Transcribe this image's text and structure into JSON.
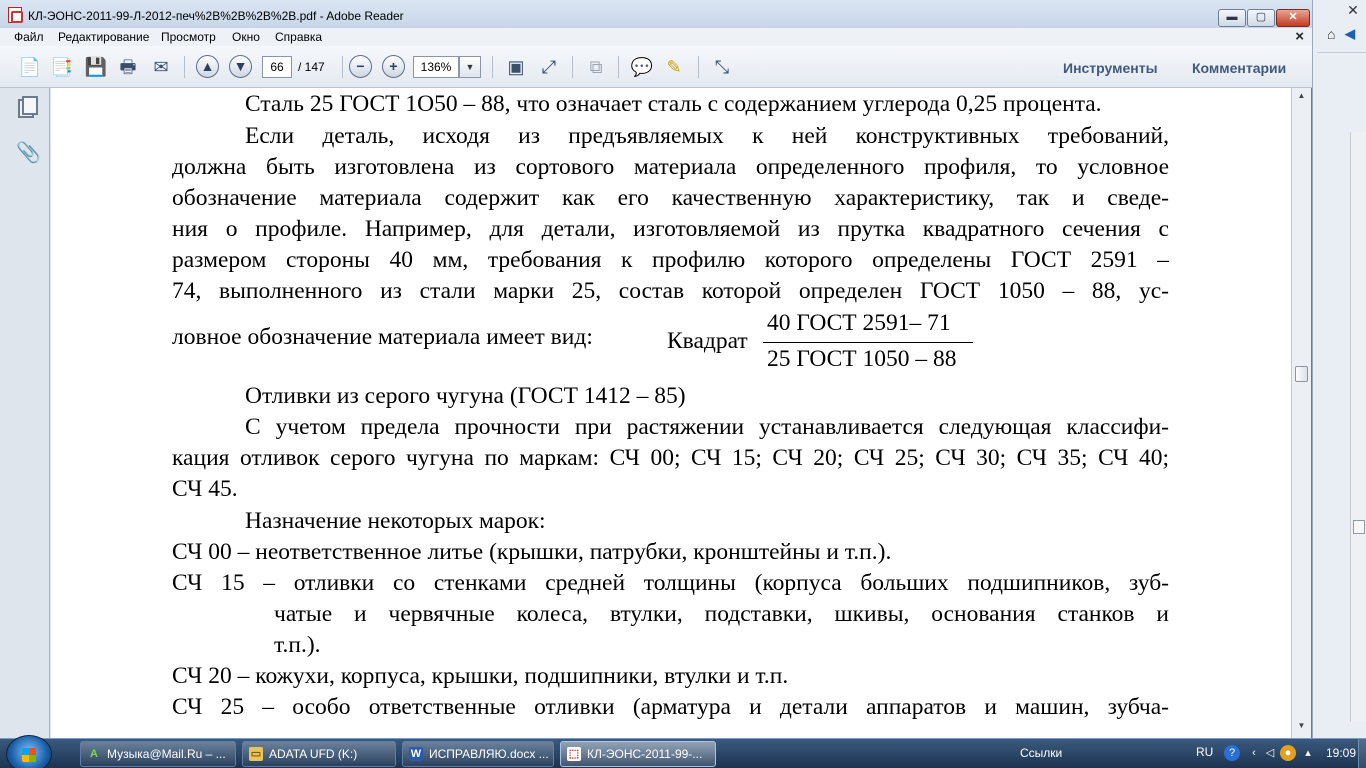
{
  "window": {
    "title": "КЛ-ЭОНС-2011-99-Л-2012-печ%2B%2B%2B%2B.pdf - Adobe Reader",
    "min_label": "▬",
    "max_label": "▢",
    "close_label": "✕"
  },
  "menu": {
    "items": [
      "Файл",
      "Редактирование",
      "Просмотр",
      "Окно",
      "Справка"
    ],
    "close_label": "×"
  },
  "toolbar": {
    "page_current": "66",
    "page_total": "/ 147",
    "zoom": "136%",
    "tools_label": "Инструменты",
    "comments_label": "Комментарии",
    "icons": [
      "create-icon",
      "combine-icon",
      "save-icon",
      "print-icon",
      "email-icon",
      "prev-page-icon",
      "next-page-icon",
      "zoom-out-icon",
      "zoom-in-icon",
      "fit-page-icon",
      "fit-width-icon",
      "copy-icon",
      "comment-icon",
      "highlight-icon",
      "fullscreen-icon"
    ]
  },
  "nav": {
    "icons": [
      "pages-icon",
      "attachment-icon"
    ]
  },
  "document": {
    "lines": [
      "Сталь 25 ГОСТ 1О50 – 88, что означает сталь с содержанием углерода 0,25 процента.",
      "Если деталь, исходя из предъявляемых к ней конструктивных требований,",
      "должна быть изготовлена из сортового материала определенного профиля, то условное",
      "обозначение материала содержит как его качественную характеристику, так и сведе-",
      "ния о профиле. Например, для детали, изготовляемой из прутка квадратного сечения с",
      "размером стороны 40 мм, требования к профилю которого определены ГОСТ 2591 –",
      "74, выполненного из стали марки 25, состав которой определен ГОСТ 1050 – 88, ус-",
      "ловное обозначение материала имеет вид:"
    ],
    "fraction": {
      "keyword": "Квадрат",
      "numerator": "40 ГОСТ 2591– 71",
      "denominator": "25 ГОСТ 1050 – 88"
    },
    "lines2": [
      "Отливки из серого чугуна (ГОСТ 1412 – 85)",
      "С учетом предела прочности при растяжении устанавливается следующая классифи-",
      "кация отливок серого чугуна по маркам: СЧ 00; СЧ 15; СЧ 20; СЧ 25; СЧ 30; СЧ 35; СЧ 40;",
      "СЧ 45.",
      "Назначение некоторых марок:",
      "СЧ 00 – неответственное литье (крышки, патрубки, кронштейны и т.п.).",
      "СЧ 15 – отливки со стенками средней толщины (корпуса больших подшипников, зуб-",
      "чатые и червячные колеса, втулки, подставки, шкивы, основания станков и",
      "т.п.).",
      "СЧ 20 – кожухи, корпуса, крышки, подшипники, втулки и т.п.",
      "СЧ 25 – особо ответственные отливки (арматура и детали аппаратов и машин, зубча-"
    ]
  },
  "taskbar": {
    "tasks": [
      {
        "label": "Музыка@Mail.Ru – ...",
        "icon": "mailru-icon"
      },
      {
        "label": "ADATA UFD (K:)",
        "icon": "folder-icon"
      },
      {
        "label": "ИСПРАВЛЯЮ.docx ...",
        "icon": "word-icon"
      },
      {
        "label": "КЛ-ЭОНС-2011-99-...",
        "icon": "pdf-icon"
      }
    ],
    "links_label": "Ссылки",
    "lang": "RU",
    "clock": "19:09"
  },
  "colors": {
    "accent": "#3f5a7e",
    "taskbar": "#1c3350",
    "pdf_red": "#c33"
  }
}
